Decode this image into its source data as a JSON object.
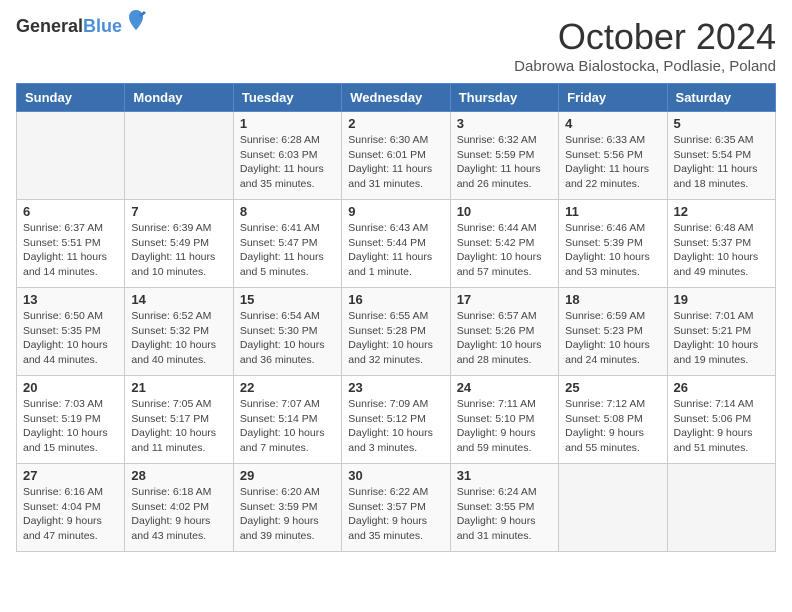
{
  "header": {
    "logo_general": "General",
    "logo_blue": "Blue",
    "month": "October 2024",
    "location": "Dabrowa Bialostocka, Podlasie, Poland"
  },
  "weekdays": [
    "Sunday",
    "Monday",
    "Tuesday",
    "Wednesday",
    "Thursday",
    "Friday",
    "Saturday"
  ],
  "weeks": [
    [
      {
        "day": null,
        "num": "",
        "sunrise": "",
        "sunset": "",
        "daylight": ""
      },
      {
        "day": null,
        "num": "",
        "sunrise": "",
        "sunset": "",
        "daylight": ""
      },
      {
        "num": "1",
        "sunrise": "Sunrise: 6:28 AM",
        "sunset": "Sunset: 6:03 PM",
        "daylight": "Daylight: 11 hours and 35 minutes."
      },
      {
        "num": "2",
        "sunrise": "Sunrise: 6:30 AM",
        "sunset": "Sunset: 6:01 PM",
        "daylight": "Daylight: 11 hours and 31 minutes."
      },
      {
        "num": "3",
        "sunrise": "Sunrise: 6:32 AM",
        "sunset": "Sunset: 5:59 PM",
        "daylight": "Daylight: 11 hours and 26 minutes."
      },
      {
        "num": "4",
        "sunrise": "Sunrise: 6:33 AM",
        "sunset": "Sunset: 5:56 PM",
        "daylight": "Daylight: 11 hours and 22 minutes."
      },
      {
        "num": "5",
        "sunrise": "Sunrise: 6:35 AM",
        "sunset": "Sunset: 5:54 PM",
        "daylight": "Daylight: 11 hours and 18 minutes."
      }
    ],
    [
      {
        "num": "6",
        "sunrise": "Sunrise: 6:37 AM",
        "sunset": "Sunset: 5:51 PM",
        "daylight": "Daylight: 11 hours and 14 minutes."
      },
      {
        "num": "7",
        "sunrise": "Sunrise: 6:39 AM",
        "sunset": "Sunset: 5:49 PM",
        "daylight": "Daylight: 11 hours and 10 minutes."
      },
      {
        "num": "8",
        "sunrise": "Sunrise: 6:41 AM",
        "sunset": "Sunset: 5:47 PM",
        "daylight": "Daylight: 11 hours and 5 minutes."
      },
      {
        "num": "9",
        "sunrise": "Sunrise: 6:43 AM",
        "sunset": "Sunset: 5:44 PM",
        "daylight": "Daylight: 11 hours and 1 minute."
      },
      {
        "num": "10",
        "sunrise": "Sunrise: 6:44 AM",
        "sunset": "Sunset: 5:42 PM",
        "daylight": "Daylight: 10 hours and 57 minutes."
      },
      {
        "num": "11",
        "sunrise": "Sunrise: 6:46 AM",
        "sunset": "Sunset: 5:39 PM",
        "daylight": "Daylight: 10 hours and 53 minutes."
      },
      {
        "num": "12",
        "sunrise": "Sunrise: 6:48 AM",
        "sunset": "Sunset: 5:37 PM",
        "daylight": "Daylight: 10 hours and 49 minutes."
      }
    ],
    [
      {
        "num": "13",
        "sunrise": "Sunrise: 6:50 AM",
        "sunset": "Sunset: 5:35 PM",
        "daylight": "Daylight: 10 hours and 44 minutes."
      },
      {
        "num": "14",
        "sunrise": "Sunrise: 6:52 AM",
        "sunset": "Sunset: 5:32 PM",
        "daylight": "Daylight: 10 hours and 40 minutes."
      },
      {
        "num": "15",
        "sunrise": "Sunrise: 6:54 AM",
        "sunset": "Sunset: 5:30 PM",
        "daylight": "Daylight: 10 hours and 36 minutes."
      },
      {
        "num": "16",
        "sunrise": "Sunrise: 6:55 AM",
        "sunset": "Sunset: 5:28 PM",
        "daylight": "Daylight: 10 hours and 32 minutes."
      },
      {
        "num": "17",
        "sunrise": "Sunrise: 6:57 AM",
        "sunset": "Sunset: 5:26 PM",
        "daylight": "Daylight: 10 hours and 28 minutes."
      },
      {
        "num": "18",
        "sunrise": "Sunrise: 6:59 AM",
        "sunset": "Sunset: 5:23 PM",
        "daylight": "Daylight: 10 hours and 24 minutes."
      },
      {
        "num": "19",
        "sunrise": "Sunrise: 7:01 AM",
        "sunset": "Sunset: 5:21 PM",
        "daylight": "Daylight: 10 hours and 19 minutes."
      }
    ],
    [
      {
        "num": "20",
        "sunrise": "Sunrise: 7:03 AM",
        "sunset": "Sunset: 5:19 PM",
        "daylight": "Daylight: 10 hours and 15 minutes."
      },
      {
        "num": "21",
        "sunrise": "Sunrise: 7:05 AM",
        "sunset": "Sunset: 5:17 PM",
        "daylight": "Daylight: 10 hours and 11 minutes."
      },
      {
        "num": "22",
        "sunrise": "Sunrise: 7:07 AM",
        "sunset": "Sunset: 5:14 PM",
        "daylight": "Daylight: 10 hours and 7 minutes."
      },
      {
        "num": "23",
        "sunrise": "Sunrise: 7:09 AM",
        "sunset": "Sunset: 5:12 PM",
        "daylight": "Daylight: 10 hours and 3 minutes."
      },
      {
        "num": "24",
        "sunrise": "Sunrise: 7:11 AM",
        "sunset": "Sunset: 5:10 PM",
        "daylight": "Daylight: 9 hours and 59 minutes."
      },
      {
        "num": "25",
        "sunrise": "Sunrise: 7:12 AM",
        "sunset": "Sunset: 5:08 PM",
        "daylight": "Daylight: 9 hours and 55 minutes."
      },
      {
        "num": "26",
        "sunrise": "Sunrise: 7:14 AM",
        "sunset": "Sunset: 5:06 PM",
        "daylight": "Daylight: 9 hours and 51 minutes."
      }
    ],
    [
      {
        "num": "27",
        "sunrise": "Sunrise: 6:16 AM",
        "sunset": "Sunset: 4:04 PM",
        "daylight": "Daylight: 9 hours and 47 minutes."
      },
      {
        "num": "28",
        "sunrise": "Sunrise: 6:18 AM",
        "sunset": "Sunset: 4:02 PM",
        "daylight": "Daylight: 9 hours and 43 minutes."
      },
      {
        "num": "29",
        "sunrise": "Sunrise: 6:20 AM",
        "sunset": "Sunset: 3:59 PM",
        "daylight": "Daylight: 9 hours and 39 minutes."
      },
      {
        "num": "30",
        "sunrise": "Sunrise: 6:22 AM",
        "sunset": "Sunset: 3:57 PM",
        "daylight": "Daylight: 9 hours and 35 minutes."
      },
      {
        "num": "31",
        "sunrise": "Sunrise: 6:24 AM",
        "sunset": "Sunset: 3:55 PM",
        "daylight": "Daylight: 9 hours and 31 minutes."
      },
      {
        "day": null,
        "num": "",
        "sunrise": "",
        "sunset": "",
        "daylight": ""
      },
      {
        "day": null,
        "num": "",
        "sunrise": "",
        "sunset": "",
        "daylight": ""
      }
    ]
  ]
}
